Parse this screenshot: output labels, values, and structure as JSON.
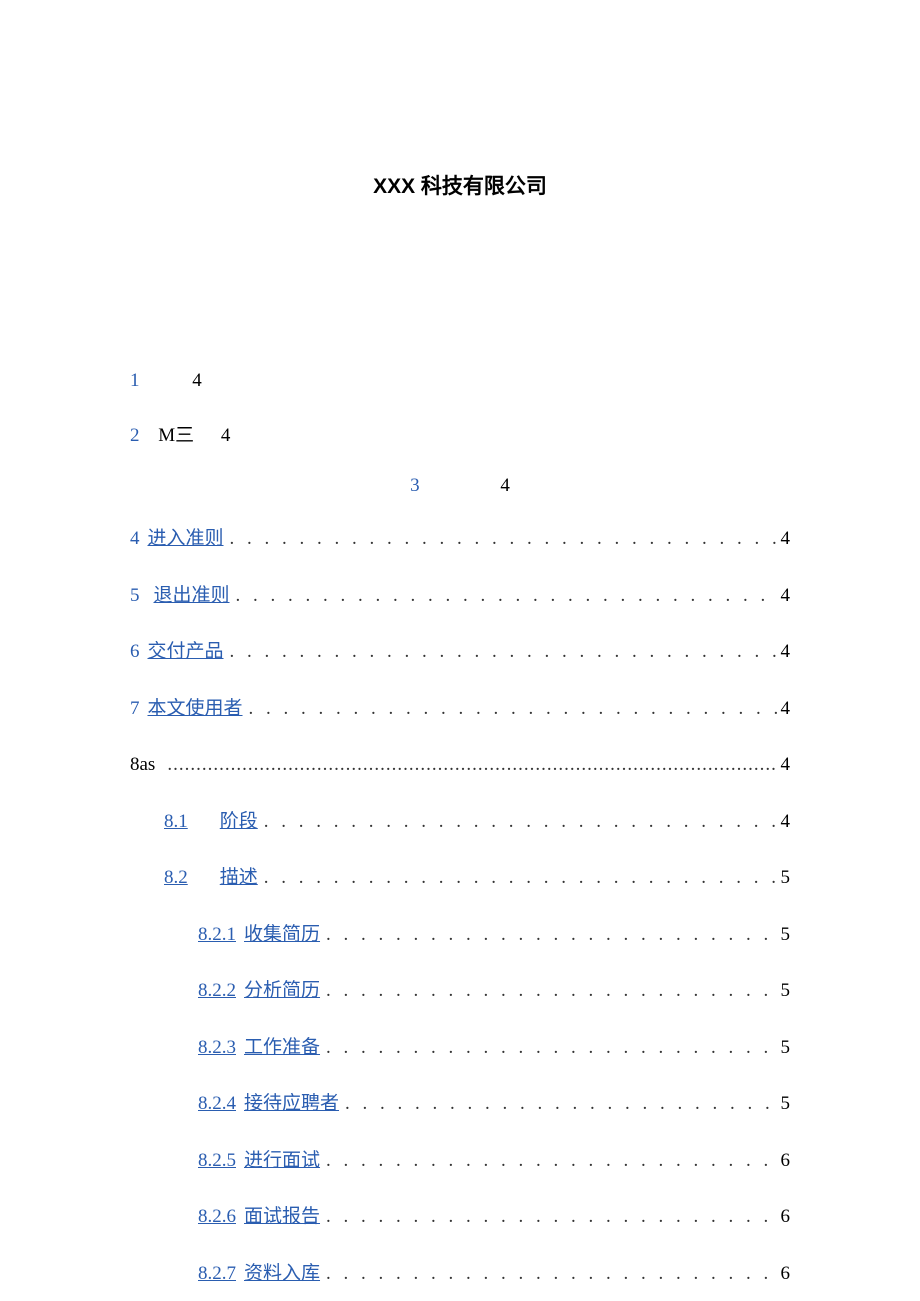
{
  "title": "XXX 科技有限公司",
  "toc": {
    "row1": {
      "left": "1",
      "right": "4"
    },
    "row2": {
      "left": "2",
      "mid": "M三",
      "right": "4"
    },
    "row3": {
      "left": "3",
      "right": "4"
    },
    "rows": [
      {
        "num": "4",
        "label": "进入准则",
        "page": "4",
        "indent": 0,
        "numUnderline": false
      },
      {
        "num": "5",
        "label": "退出准则",
        "page": "4",
        "indent": 0,
        "numUnderline": false,
        "space": true
      },
      {
        "num": "6",
        "label": "交付产品",
        "page": "4",
        "indent": 0,
        "numUnderline": false
      },
      {
        "num": "7",
        "label": "本文使用者",
        "page": "4",
        "indent": 0,
        "numUnderline": false
      },
      {
        "num": "8as",
        "label": "",
        "page": "4",
        "indent": 0,
        "numUnderline": false,
        "plain": true,
        "tight": true
      },
      {
        "num": "8.1",
        "label": "阶段",
        "page": "4",
        "indent": 1,
        "numUnderline": true,
        "wide": true
      },
      {
        "num": "8.2",
        "label": "描述",
        "page": "5",
        "indent": 1,
        "numUnderline": true,
        "wide": true
      },
      {
        "num": "8.2.1",
        "label": "收集简历",
        "page": "5",
        "indent": 2,
        "numUnderline": true
      },
      {
        "num": "8.2.2",
        "label": "分析简历",
        "page": "5",
        "indent": 2,
        "numUnderline": true
      },
      {
        "num": "8.2.3",
        "label": "工作准备",
        "page": "5",
        "indent": 2,
        "numUnderline": true
      },
      {
        "num": "8.2.4",
        "label": "接待应聘者",
        "page": "5",
        "indent": 2,
        "numUnderline": true
      },
      {
        "num": "8.2.5",
        "label": "进行面试",
        "page": "6",
        "indent": 2,
        "numUnderline": true
      },
      {
        "num": "8.2.6",
        "label": "面试报告",
        "page": "6",
        "indent": 2,
        "numUnderline": true
      },
      {
        "num": "8.2.7",
        "label": "资料入库",
        "page": "6",
        "indent": 2,
        "numUnderline": true
      }
    ]
  },
  "dots": ". . . . . . . . . . . . . . . . . . . . . . . . . . . . . . . . . . . . . . . . . . . . . . . . . . . . . . . . . . . . . . . . . . . . . . . . . . . . . . . . . . . . . . . . . . . . . . . . . . . .",
  "dotsTight": "..............................................................................................................................................................................."
}
